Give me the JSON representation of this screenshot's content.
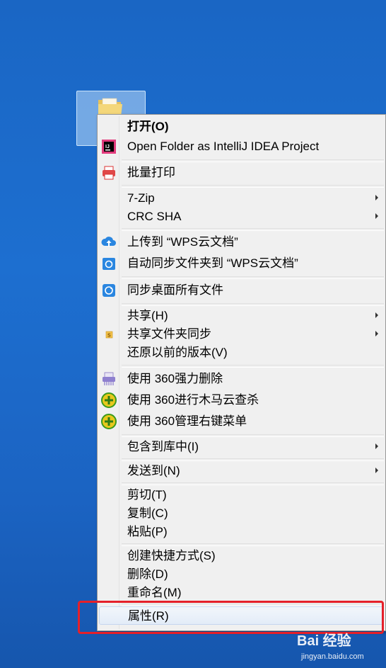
{
  "desktop": {
    "icon": "folder-icon"
  },
  "context_menu": {
    "items": [
      {
        "label": "打开(O)",
        "bold": true,
        "icon": ""
      },
      {
        "label": "Open Folder as IntelliJ IDEA Project",
        "icon": "intellij-icon"
      },
      {
        "label": "批量打印",
        "icon": "printer-icon"
      },
      {
        "label": "7-Zip",
        "submenu": true
      },
      {
        "label": "CRC SHA",
        "submenu": true
      },
      {
        "label": "上传到 “WPS云文档”",
        "icon": "cloud-upload-icon"
      },
      {
        "label": "自动同步文件夹到 “WPS云文档”",
        "icon": "sync-folder-icon"
      },
      {
        "label": "同步桌面所有文件",
        "icon": "sync-desktop-icon"
      },
      {
        "label": "共享(H)",
        "submenu": true
      },
      {
        "label": "共享文件夹同步",
        "submenu": true,
        "icon": "wps-s-icon"
      },
      {
        "label": "还原以前的版本(V)"
      },
      {
        "label": "使用 360强力删除",
        "icon": "shredder-icon"
      },
      {
        "label": "使用 360进行木马云查杀",
        "icon": "360-plus-icon"
      },
      {
        "label": "使用 360管理右键菜单",
        "icon": "360-plus-icon"
      },
      {
        "label": "包含到库中(I)",
        "submenu": true
      },
      {
        "label": "发送到(N)",
        "submenu": true
      },
      {
        "label": "剪切(T)"
      },
      {
        "label": "复制(C)"
      },
      {
        "label": "粘贴(P)"
      },
      {
        "label": "创建快捷方式(S)"
      },
      {
        "label": "删除(D)"
      },
      {
        "label": "重命名(M)"
      },
      {
        "label": "属性(R)",
        "highlighted": true
      }
    ]
  },
  "annotation": {
    "color": "#e5202a"
  },
  "watermark": {
    "text": "Bai 经验",
    "sub": "jingyan.baidu.com"
  }
}
